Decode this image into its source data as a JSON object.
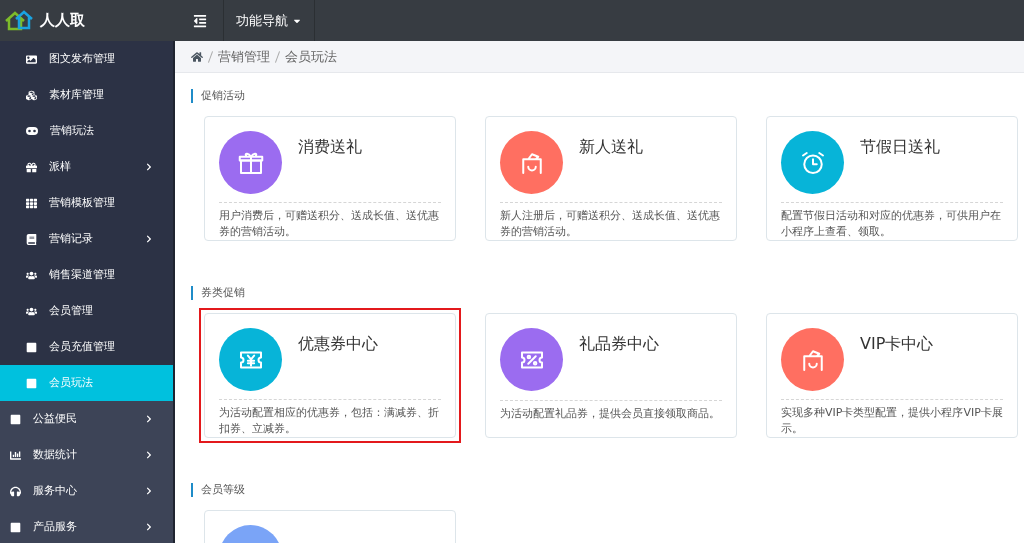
{
  "header": {
    "brand": "人人取",
    "nav_menu": "功能导航"
  },
  "sidebar": {
    "items": [
      {
        "label": "图文发布管理",
        "kind": "sub",
        "selected": false,
        "expandable": false
      },
      {
        "label": "素材库管理",
        "kind": "sub",
        "selected": false,
        "expandable": false
      },
      {
        "label": "营销玩法",
        "kind": "sub",
        "selected": false,
        "expandable": false
      },
      {
        "label": "派样",
        "kind": "sub",
        "selected": false,
        "expandable": true
      },
      {
        "label": "营销模板管理",
        "kind": "sub",
        "selected": false,
        "expandable": false
      },
      {
        "label": "营销记录",
        "kind": "sub",
        "selected": false,
        "expandable": true
      },
      {
        "label": "销售渠道管理",
        "kind": "sub",
        "selected": false,
        "expandable": false
      },
      {
        "label": "会员管理",
        "kind": "sub",
        "selected": false,
        "expandable": false
      },
      {
        "label": "会员充值管理",
        "kind": "sub",
        "selected": false,
        "expandable": false
      },
      {
        "label": "会员玩法",
        "kind": "sub",
        "selected": true,
        "expandable": false
      },
      {
        "label": "公益便民",
        "kind": "top",
        "selected": false,
        "expandable": true
      },
      {
        "label": "数据统计",
        "kind": "top",
        "selected": false,
        "expandable": true
      },
      {
        "label": "服务中心",
        "kind": "top",
        "selected": false,
        "expandable": true
      },
      {
        "label": "产品服务",
        "kind": "top",
        "selected": false,
        "expandable": true
      }
    ]
  },
  "breadcrumb": [
    "营销管理",
    "会员玩法"
  ],
  "sections": [
    {
      "title": "促销活动",
      "cards": [
        {
          "title": "消费送礼",
          "description": "用户消费后，可赠送积分、送成长值、送优惠券的营销活动。",
          "color": "#9b6cf0",
          "selected": false
        },
        {
          "title": "新人送礼",
          "description": "新人注册后，可赠送积分、送成长值、送优惠券的营销活动。",
          "color": "#ff6f61",
          "selected": false
        },
        {
          "title": "节假日送礼",
          "description": "配置节假日活动和对应的优惠券，可供用户在小程序上查看、领取。",
          "color": "#07b4d8",
          "selected": false
        }
      ]
    },
    {
      "title": "券类促销",
      "cards": [
        {
          "title": "优惠券中心",
          "description": "为活动配置相应的优惠券，包括：满减券、折扣券、立减券。",
          "color": "#07b4d8",
          "selected": true
        },
        {
          "title": "礼品券中心",
          "description": "为活动配置礼品券，提供会员直接领取商品。",
          "color": "#9b6cf0",
          "selected": false
        },
        {
          "title": "VIP卡中心",
          "description": "实现多种VIP卡类型配置，提供小程序VIP卡展示。",
          "color": "#ff6f61",
          "selected": false
        }
      ]
    },
    {
      "title": "会员等级",
      "cards": [
        {
          "color": "#7aa4f7",
          "selected": false
        }
      ]
    }
  ]
}
